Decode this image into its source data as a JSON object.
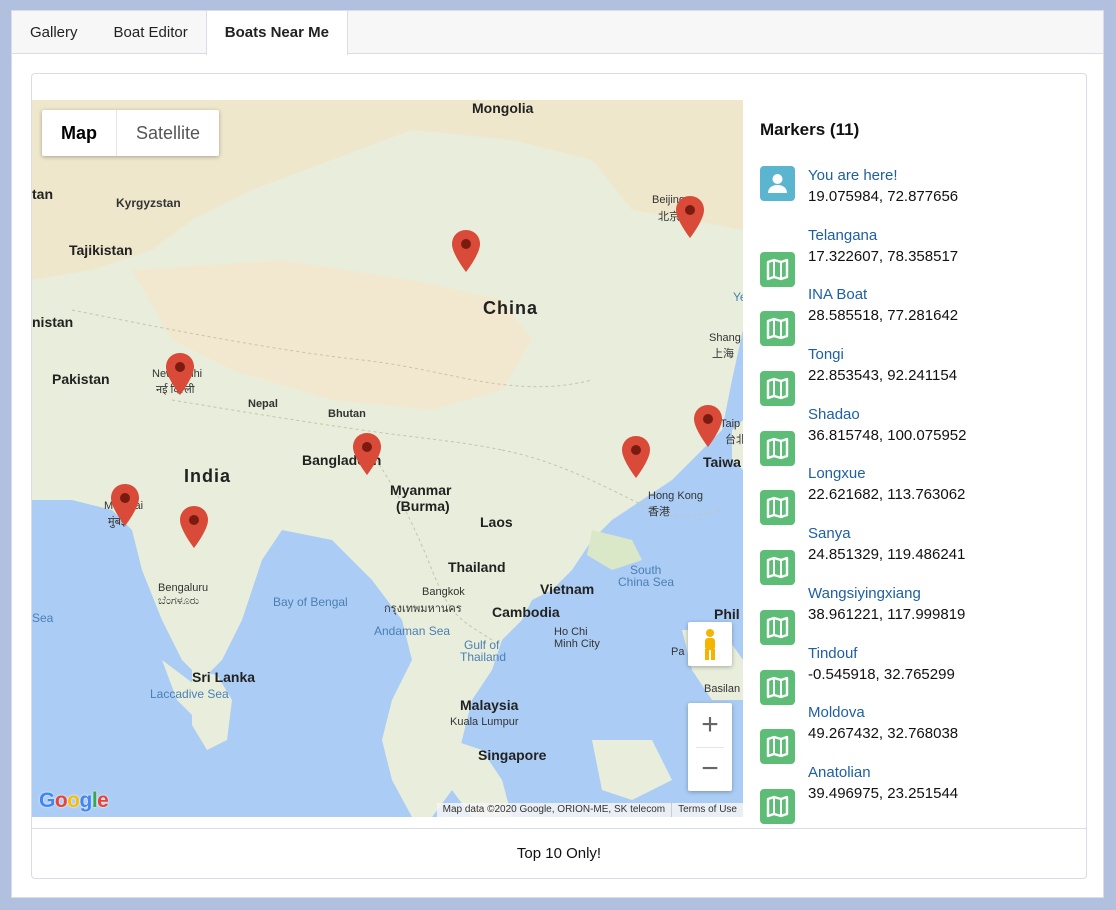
{
  "tabs": [
    {
      "label": "Gallery",
      "active": false
    },
    {
      "label": "Boat Editor",
      "active": false
    },
    {
      "label": "Boats Near Me",
      "active": true
    }
  ],
  "map": {
    "type_controls": {
      "map": "Map",
      "satellite": "Satellite",
      "selected": "Map"
    },
    "labels": {
      "mongolia": "Mongolia",
      "kyrgyzstan": "Kyrgyzstan",
      "tan": "tan",
      "tajikistan": "Tajikistan",
      "nistan": "nistan",
      "pakistan": "Pakistan",
      "new_delhi": "New Delhi",
      "new_delhi_hindi": "नई दिल्ली",
      "nepal": "Nepal",
      "bhutan": "Bhutan",
      "china": "China",
      "beijing": "Beijing",
      "beijing_zh": "北京",
      "shang": "Shang",
      "shang_zh": "上海",
      "taipei": "Taip",
      "taipei_zh": "台北",
      "taiwan": "Taiwa",
      "y": "Ye",
      "bangladesh": "Bangladesh",
      "india": "India",
      "mumbai": "Mumbai",
      "mumbai_mr": "मुंबई",
      "myanmar": "Myanmar",
      "burma": "(Burma)",
      "laos": "Laos",
      "hong_kong": "Hong Kong",
      "hong_kong_zh": "香港",
      "south_china_sea_1": "South",
      "south_china_sea_2": "China Sea",
      "thailand": "Thailand",
      "bangkok": "Bangkok",
      "bangkok_th": "กรุงเทพมหานคร",
      "vietnam": "Vietnam",
      "cambodia": "Cambodia",
      "ho_chi_minh_1": "Ho Chi",
      "ho_chi_minh_2": "Minh City",
      "bengaluru": "Bengaluru",
      "bengaluru_kn": "ಬೆಂಗಳೂರು",
      "bay_of_bengal": "Bay of Bengal",
      "sea": "Sea",
      "andaman_sea": "Andaman Sea",
      "gulf_1": "Gulf of",
      "gulf_2": "Thailand",
      "sri_lanka": "Sri Lanka",
      "laccadive": "Laccadive Sea",
      "malaysia": "Malaysia",
      "kuala_lumpur": "Kuala Lumpur",
      "singapore": "Singapore",
      "phil": "Phil",
      "pa": "Pa",
      "basilan": "Basilan"
    },
    "zoom_in": "+",
    "zoom_out": "−",
    "logo": "Google",
    "attribution": "Map data ©2020 Google, ORION-ME, SK telecom",
    "terms": "Terms of Use"
  },
  "markers": {
    "title": "Markers (11)",
    "items": [
      {
        "name": "You are here!",
        "coords": "19.075984, 72.877656",
        "icon": "user-icon"
      },
      {
        "name": "Telangana",
        "coords": "17.322607, 78.358517",
        "icon": "map-icon"
      },
      {
        "name": "INA Boat",
        "coords": "28.585518, 77.281642",
        "icon": "map-icon"
      },
      {
        "name": "Tongi",
        "coords": "22.853543, 92.241154",
        "icon": "map-icon"
      },
      {
        "name": "Shadao",
        "coords": "36.815748, 100.075952",
        "icon": "map-icon"
      },
      {
        "name": "Longxue",
        "coords": "22.621682, 113.763062",
        "icon": "map-icon"
      },
      {
        "name": "Sanya",
        "coords": "24.851329, 119.486241",
        "icon": "map-icon"
      },
      {
        "name": "Wangsiyingxiang",
        "coords": "38.961221, 117.999819",
        "icon": "map-icon"
      },
      {
        "name": "Tindouf",
        "coords": "-0.545918, 32.765299",
        "icon": "map-icon"
      },
      {
        "name": "Moldova",
        "coords": "49.267432, 32.768038",
        "icon": "map-icon"
      },
      {
        "name": "Anatolian",
        "coords": "39.496975, 23.251544",
        "icon": "map-icon"
      }
    ]
  },
  "footer": {
    "label": "Top 10 Only!"
  },
  "colors": {
    "pin": "#d94a38",
    "user_icon_bg": "#5bb5cf",
    "map_icon_bg": "#5dbd77",
    "link": "#1f5fa4",
    "water": "#abcdf5",
    "land": "#e8eedb"
  }
}
